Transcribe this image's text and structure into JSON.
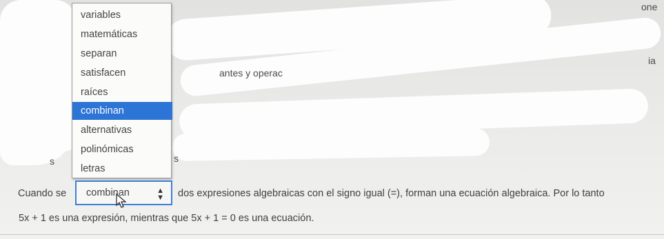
{
  "dropdown": {
    "options": [
      "variables",
      "matemáticas",
      "separan",
      "satisfacen",
      "raíces",
      "combinan",
      "alternativas",
      "polinómicas",
      "letras"
    ],
    "selected_index": 5
  },
  "fragments": {
    "top_right": "one",
    "right_ia": "ia",
    "mid": "antes y operac",
    "left_s": "s",
    "right_s": "s"
  },
  "sentence": {
    "before": "Cuando se",
    "selected_value": "combinan",
    "after": "dos expresiones algebraicas con el signo igual (=), forman una ecuación algebraica. Por lo tanto",
    "line2": "5x + 1 es una expresión, mientras que 5x + 1 = 0 es una ecuación."
  },
  "colors": {
    "selection": "#2c74d5",
    "select_border": "#3d7fd8"
  },
  "icons": {
    "select_arrows": "up-down-chevron",
    "cursor": "mouse-pointer"
  }
}
